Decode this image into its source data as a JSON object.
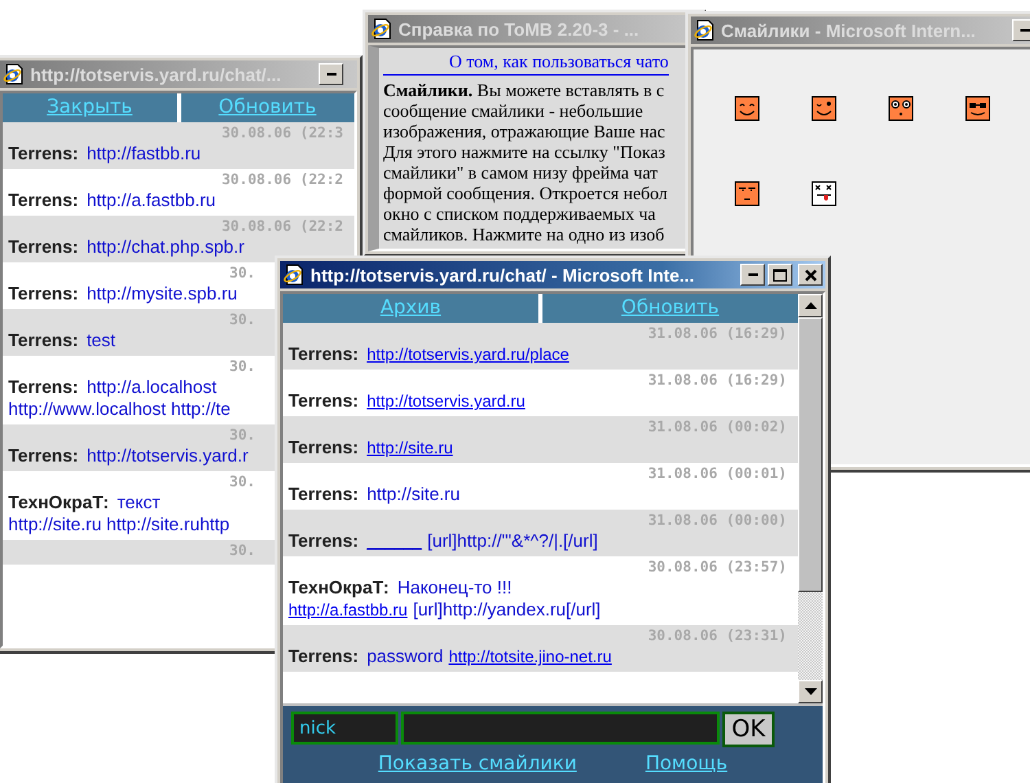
{
  "windows": [
    {
      "kind": "chat",
      "active": false,
      "title": "http://totservis.yard.ru/chat/...",
      "nav": [
        "Закрыть",
        "Обновить"
      ],
      "messages": [
        {
          "time": "30.08.06 (22:3",
          "author": "Terrens:",
          "lines": [
            [
              {
                "kind": "text",
                "text": "http://fastbb.ru"
              }
            ]
          ]
        },
        {
          "time": "30.08.06 (22:2",
          "author": "Terrens:",
          "lines": [
            [
              {
                "kind": "text",
                "text": "http://a.fastbb.ru"
              }
            ]
          ]
        },
        {
          "time": "30.08.06 (22:2",
          "author": "Terrens:",
          "lines": [
            [
              {
                "kind": "text",
                "text": "http://chat.php.spb.r"
              }
            ]
          ]
        },
        {
          "time": "30.",
          "author": "Terrens:",
          "lines": [
            [
              {
                "kind": "text",
                "text": "http://mysite.spb.ru"
              }
            ]
          ]
        },
        {
          "time": "30.",
          "author": "Terrens:",
          "lines": [
            [
              {
                "kind": "text",
                "text": "test"
              }
            ]
          ]
        },
        {
          "time": "30.",
          "author": "Terrens:",
          "lines": [
            [
              {
                "kind": "text",
                "text": "http://a.localhost"
              }
            ],
            [
              {
                "kind": "text",
                "text": "http://www.localhost http://te"
              }
            ]
          ]
        },
        {
          "time": "30.",
          "author": "Terrens:",
          "lines": [
            [
              {
                "kind": "text",
                "text": "http://totservis.yard.r"
              }
            ]
          ]
        },
        {
          "time": "30.",
          "author": "ТехнОкраТ:",
          "lines": [
            [
              {
                "kind": "text",
                "text": "текст"
              }
            ],
            [
              {
                "kind": "text",
                "text": "http://site.ru http://site.ruhttp"
              }
            ]
          ]
        },
        {
          "time": "30."
        }
      ]
    },
    {
      "kind": "help",
      "active": false,
      "title": "Справка по ToMB 2.20-3 - ...",
      "heading": "О том, как пользоваться чато",
      "body": "**Смайлики.** Вы можете вставлять в с\nсообщение смайлики - небольшие\nизображения, отражающие Ваше нас\nДля этого нажмите на ссылку \"Показ\nсмайлики\" в самом низу фрейма чат\nформой сообщения. Откроется небол\nокно с списком поддерживаемых ча\nсмайликов. Нажмите на одно из изоб"
    },
    {
      "kind": "smileys",
      "active": false,
      "title": "Смайлики - Microsoft Intern..."
    },
    {
      "kind": "chat",
      "active": true,
      "title": "http://totservis.yard.ru/chat/ - Microsoft Inte...",
      "nav": [
        "Архив",
        "Обновить"
      ],
      "messages": [
        {
          "time": "31.08.06 (16:29)",
          "author": "Terrens:",
          "lines": [
            [
              {
                "kind": "link",
                "text": "http://totservis.yard.ru/place"
              }
            ]
          ]
        },
        {
          "time": "31.08.06 (16:29)",
          "author": "Terrens:",
          "lines": [
            [
              {
                "kind": "link",
                "text": "http://totservis.yard.ru"
              }
            ]
          ]
        },
        {
          "time": "31.08.06 (00:02)",
          "author": "Terrens:",
          "lines": [
            [
              {
                "kind": "link",
                "text": "http://site.ru"
              }
            ]
          ]
        },
        {
          "time": "31.08.06 (00:01)",
          "author": "Terrens:",
          "lines": [
            [
              {
                "kind": "text",
                "text": "http://site.ru"
              }
            ]
          ]
        },
        {
          "time": "31.08.06 (00:00)",
          "author": "Terrens:",
          "lines": [
            [
              {
                "kind": "blank",
                "text": "______"
              },
              {
                "kind": "text",
                "text": "[url]http://'\"&*^?/|.[/url]"
              }
            ]
          ]
        },
        {
          "time": "30.08.06 (23:57)",
          "author": "ТехнОкраТ:",
          "lines": [
            [
              {
                "kind": "text",
                "text": "Наконец-то !!!"
              }
            ],
            [
              {
                "kind": "link",
                "text": "http://a.fastbb.ru"
              },
              {
                "kind": "text",
                "text": "[url]http://yandex.ru[/url]"
              }
            ]
          ]
        },
        {
          "time": "30.08.06 (23:31)",
          "author": "Terrens:",
          "lines": [
            [
              {
                "kind": "text",
                "text": "password"
              },
              {
                "kind": "link",
                "text": "http://totsite.jino-net.ru"
              }
            ]
          ]
        }
      ],
      "form": {
        "nick": "nick",
        "button": "OK",
        "links": [
          "Показать смайлики",
          "Помощь"
        ]
      }
    }
  ]
}
